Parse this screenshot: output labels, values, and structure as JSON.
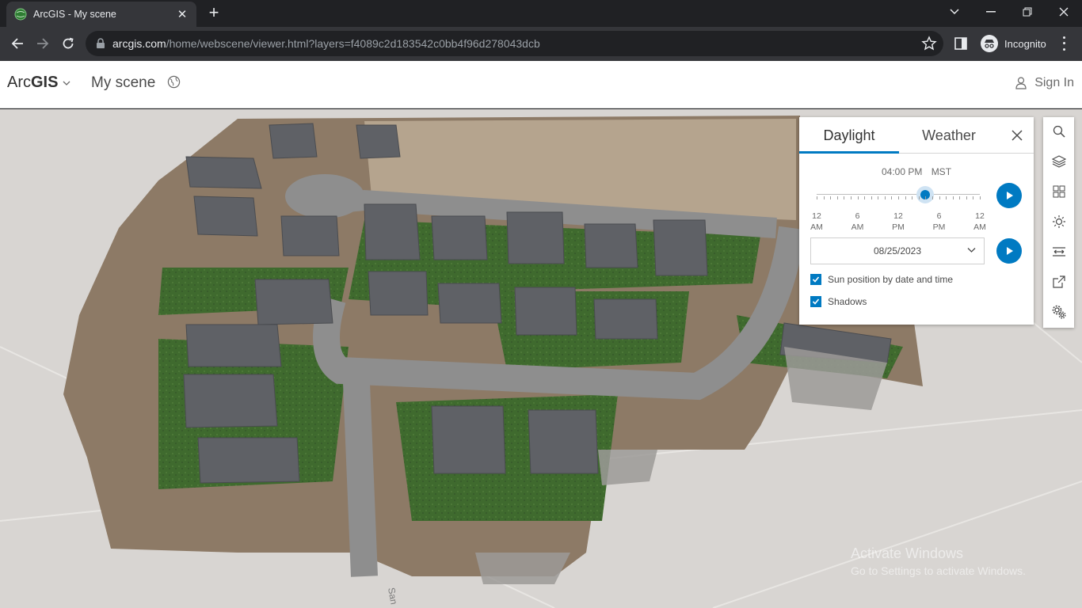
{
  "browser": {
    "tab_title": "ArcGIS - My scene",
    "url_host": "arcgis.com",
    "url_path": "/home/webscene/viewer.html?layers=f4089c2d183542c0bb4f96d278043dcb",
    "profile_label": "Incognito"
  },
  "app": {
    "brand_regular": "Arc",
    "brand_bold": "GIS",
    "scene_title": "My scene",
    "sign_in": "Sign In"
  },
  "panel": {
    "tabs": [
      "Daylight",
      "Weather"
    ],
    "active_tab": "Daylight",
    "time": "04:00 PM",
    "timezone": "MST",
    "time_of_day_fraction": 0.667,
    "tick_labels": [
      {
        "num": "12",
        "ampm": "AM"
      },
      {
        "num": "6",
        "ampm": "AM"
      },
      {
        "num": "12",
        "ampm": "PM"
      },
      {
        "num": "6",
        "ampm": "PM"
      },
      {
        "num": "12",
        "ampm": "AM"
      }
    ],
    "date": "08/25/2023",
    "checkboxes": [
      {
        "label": "Sun position by date and time",
        "checked": true
      },
      {
        "label": "Shadows",
        "checked": true
      }
    ]
  },
  "tools": [
    "search-icon",
    "layers-icon",
    "basemap-gallery-icon",
    "daylight-icon",
    "measure-icon",
    "share-icon",
    "settings-icon"
  ],
  "map": {
    "street_label": "San",
    "watermark_line1": "Activate Windows",
    "watermark_line2": "Go to Settings to activate Windows."
  },
  "colors": {
    "accent": "#007ac2",
    "chrome_dark": "#202124",
    "chrome_toolbar": "#35363a"
  }
}
